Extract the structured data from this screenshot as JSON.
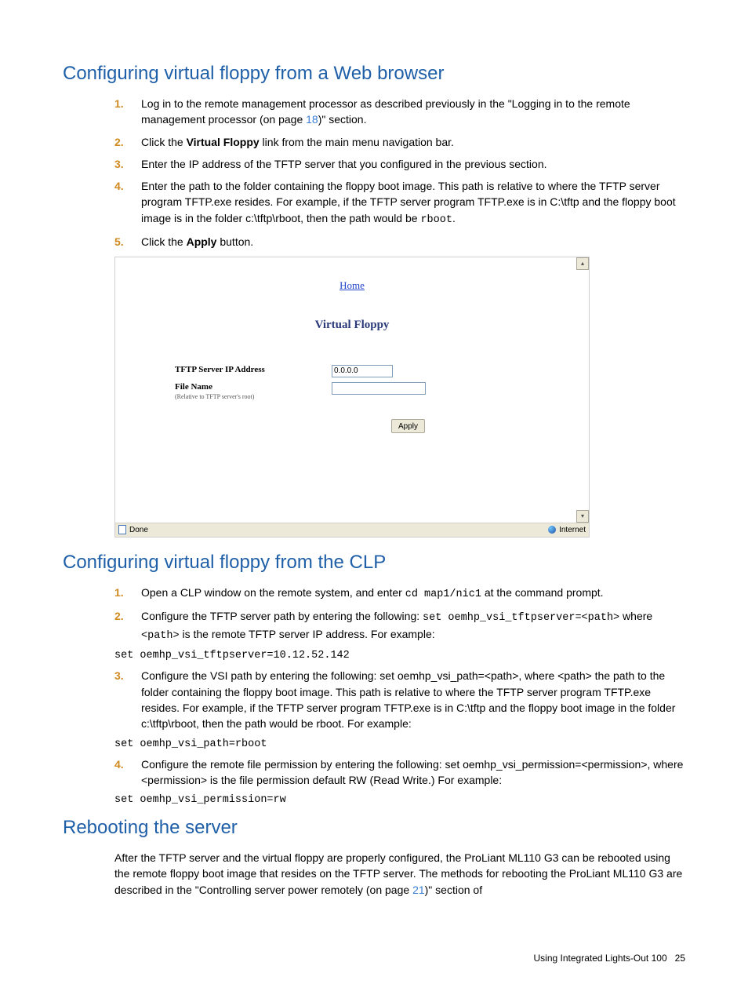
{
  "sections": {
    "web": {
      "title": "Configuring virtual floppy from a Web browser",
      "steps": [
        {
          "n": "1.",
          "pre": "Log in to the remote management processor as described previously in the \"Logging in to the remote management processor (on page ",
          "link": "18",
          "post": ")\" section."
        },
        {
          "n": "2.",
          "html": "Click the <b>Virtual Floppy</b> link from the main menu navigation bar."
        },
        {
          "n": "3.",
          "text": "Enter the IP address of the TFTP server that you configured in the previous section."
        },
        {
          "n": "4.",
          "html": "Enter the path to the folder containing the floppy boot image. This path is relative to where the TFTP server program TFTP.exe resides. For example, if the TFTP server program TFTP.exe is in C:\\tftp and the floppy boot image is in the folder c:\\tftp\\rboot, then the path would be <span class='code'>rboot</span>."
        },
        {
          "n": "5.",
          "html": "Click the <b>Apply</b> button."
        }
      ]
    },
    "clp": {
      "title": "Configuring virtual floppy from the CLP",
      "steps": [
        {
          "n": "1.",
          "html": "Open a CLP window on the remote system, and enter <span class='code'>cd map1/nic1</span> at the command prompt."
        },
        {
          "n": "2.",
          "html": "Configure the TFTP server path by entering the following: <span class='code'>set oemhp_vsi_tftpserver=&lt;path&gt;</span> where <span class='code'>&lt;path&gt;</span> is the remote TFTP server IP address. For example:",
          "code": "set oemhp_vsi_tftpserver=10.12.52.142"
        },
        {
          "n": "3.",
          "html": "Configure the VSI path by entering the following: set oemhp_vsi_path=&lt;path&gt;,  where &lt;path&gt; the path to the folder containing the floppy boot image. This path is relative to where the TFTP server program TFTP.exe resides. For example, if the TFTP server program TFTP.exe is in C:\\tftp and the floppy boot image in the folder c:\\tftp\\rboot, then the path would be rboot. For example:",
          "code": "set oemhp_vsi_path=rboot"
        },
        {
          "n": "4.",
          "html": "Configure the remote file permission by entering the following: set oemhp_vsi_permission=&lt;permission&gt;,  where &lt;permission&gt; is the file permission default RW (Read Write.) For example:",
          "code": "set oemhp_vsi_permission=rw"
        }
      ]
    },
    "reboot": {
      "title": "Rebooting the server",
      "para_pre": "After the TFTP server and the virtual floppy are properly configured, the ProLiant ML110 G3 can be rebooted using the remote floppy boot image that resides on the TFTP server. The methods for rebooting the ProLiant ML110 G3 are described in the \"Controlling server power remotely (on page ",
      "para_link": "21",
      "para_post": ")\" section of"
    }
  },
  "screenshot": {
    "home": "Home",
    "title": "Virtual Floppy",
    "labels": {
      "ip": "TFTP Server IP Address",
      "file": "File Name",
      "file_sub": "(Relative to TFTP server's root)"
    },
    "values": {
      "ip": "0.0.0.0",
      "file": ""
    },
    "apply": "Apply",
    "status_left": "Done",
    "status_right": "Internet"
  },
  "footer": {
    "text": "Using Integrated Lights-Out 100",
    "page": "25"
  }
}
